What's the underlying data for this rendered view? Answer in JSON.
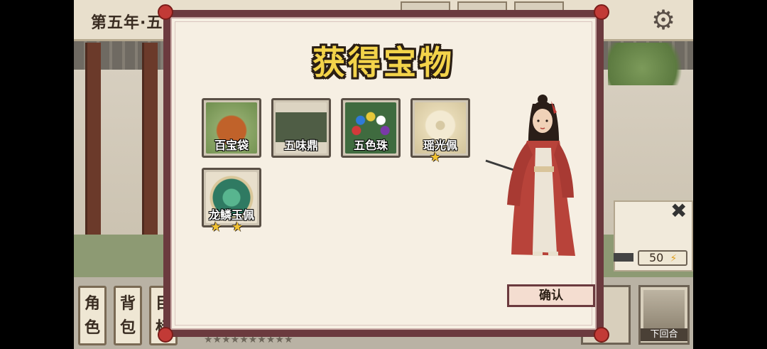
{
  "topbar": {
    "date_label": "第五年·五"
  },
  "side_menu": [
    {
      "label_top": "角",
      "label_bottom": "色"
    },
    {
      "label_top": "背",
      "label_bottom": "包"
    },
    {
      "label_top": "目",
      "label_bottom": "标"
    }
  ],
  "bottom_tabs": [
    "",
    "",
    "",
    ""
  ],
  "bottom_stars": "★★★★★★★★★★",
  "right_panel": {
    "energy": "50"
  },
  "next_turn": {
    "label": "下回合"
  },
  "modal": {
    "title": "获得宝物",
    "items": [
      {
        "name": "百宝袋",
        "stars": "",
        "icon": "money-bag-icon",
        "color": "#6f8f4e"
      },
      {
        "name": "五味鼎",
        "stars": "",
        "icon": "bronze-cauldron-icon",
        "color": "#5b6a4f"
      },
      {
        "name": "五色珠",
        "stars": "",
        "icon": "colored-beads-icon",
        "color": "#3f6b3f"
      },
      {
        "name": "瑶光佩",
        "stars": "★",
        "icon": "jade-disc-icon",
        "color": "#d7c9a3"
      },
      {
        "name": "龙鳞玉佩",
        "stars": "★★",
        "icon": "dragon-jade-icon",
        "color": "#2f7a62"
      }
    ],
    "confirm_label": "确认"
  }
}
